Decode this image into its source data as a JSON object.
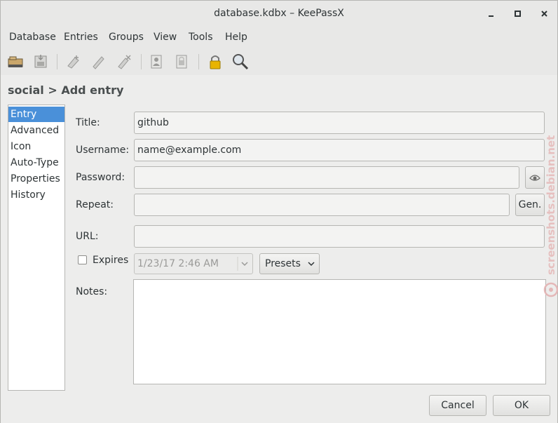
{
  "window": {
    "title": "database.kdbx – KeePassX",
    "minimize": "_",
    "maximize": "□",
    "close": "×"
  },
  "menu": [
    "Database",
    "Entries",
    "Groups",
    "View",
    "Tools",
    "Help"
  ],
  "toolbar": {
    "icons": [
      "open-database-icon",
      "save-database-icon",
      "add-entry-icon",
      "edit-entry-icon",
      "delete-entry-icon",
      "copy-username-icon",
      "copy-password-icon",
      "lock-database-icon",
      "search-icon"
    ]
  },
  "page": {
    "heading": "social > Add entry"
  },
  "categories": [
    "Entry",
    "Advanced",
    "Icon",
    "Auto-Type",
    "Properties",
    "History"
  ],
  "form": {
    "title_label": "Title:",
    "title_value": "github",
    "username_label": "Username:",
    "username_value": "name@example.com",
    "password_label": "Password:",
    "password_value": "",
    "repeat_label": "Repeat:",
    "repeat_value": "",
    "gen_label": "Gen.",
    "url_label": "URL:",
    "url_value": "",
    "expires_label": "Expires",
    "expires_checked": false,
    "expires_value": "1/23/17 2:46 AM",
    "presets_label": "Presets",
    "notes_label": "Notes:",
    "notes_value": ""
  },
  "buttons": {
    "cancel": "Cancel",
    "ok": "OK"
  },
  "watermark": "screenshots.debian.net",
  "colors": {
    "selection": "#4a90d9",
    "window_bg": "#e8e8e7",
    "lock_yellow": "#e8b400"
  }
}
